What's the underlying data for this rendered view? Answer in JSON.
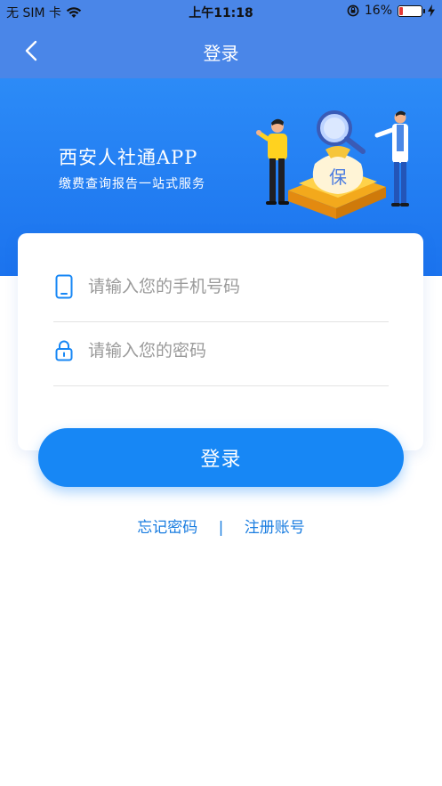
{
  "status_bar": {
    "carrier": "无 SIM 卡",
    "time": "上午11:18",
    "battery_percent": "16%",
    "battery_level": 0.16,
    "battery_color": "#e53935"
  },
  "nav": {
    "title": "登录",
    "back_icon": "chevron-left-icon"
  },
  "banner": {
    "title": "西安人社通APP",
    "subtitle": "缴费查询报告一站式服务",
    "illustration_glyph": "保"
  },
  "form": {
    "phone": {
      "icon": "phone-icon",
      "value": "",
      "placeholder": "请输入您的手机号码"
    },
    "password": {
      "icon": "lock-icon",
      "value": "",
      "placeholder": "请输入您的密码"
    }
  },
  "login_button": {
    "label": "登录"
  },
  "links": {
    "forgot": "忘记密码",
    "separator": "|",
    "register": "注册账号"
  },
  "colors": {
    "nav_blue": "#4a86e8",
    "banner_blue": "#1b73ee",
    "button_blue": "#1787f5",
    "link_blue": "#1a7de0"
  }
}
